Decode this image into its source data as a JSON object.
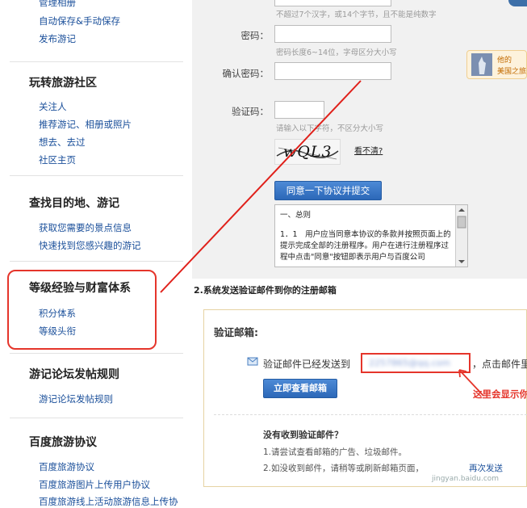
{
  "sidebar": {
    "top_links": [
      "管理相册",
      "自动保存&手动保存",
      "发布游记"
    ],
    "sections": [
      {
        "title": "玩转旅游社区",
        "links": [
          "关注人",
          "推荐游记、相册或照片",
          "想去、去过",
          "社区主页"
        ]
      },
      {
        "title": "查找目的地、游记",
        "links": [
          "获取您需要的景点信息",
          "快速找到您感兴趣的游记"
        ]
      },
      {
        "title": "等级经验与财富体系",
        "links": [
          "积分体系",
          "等级头衔"
        ]
      },
      {
        "title": "游记论坛发帖规则",
        "links": [
          "游记论坛发帖规则"
        ]
      },
      {
        "title": "百度旅游协议",
        "links": [
          "百度旅游协议",
          "百度旅游图片上传用户协议",
          "百度旅游线上活动旅游信息上传协"
        ]
      }
    ]
  },
  "form": {
    "username_hint": "不超过7个汉字，或14个字节，且不能是纯数字",
    "password_label": "密码：",
    "password_hint": "密码长度6~14位，字母区分大小写",
    "confirm_label": "确认密码：",
    "captcha_label": "验证码：",
    "captcha_hint": "请输入以下字符，不区分大小写",
    "captcha_text": "wQL3",
    "cant_see": "看不清?",
    "submit_label": "同意一下协议并提交",
    "agreement_heading": "一、总则",
    "agreement_text": "1．1　用户应当同意本协议的条款并按照页面上的提示完成全部的注册程序。用户在进行注册程序过程中点击\"同意\"按钮即表示用户与百度公司"
  },
  "promo": {
    "text_line1": "他的",
    "text_line2": "美国之旅"
  },
  "step2": {
    "title": "2.系统发送验证邮件到你的注册邮箱"
  },
  "verify": {
    "title": "验证邮箱:",
    "sent_text": "验证邮件已经发送到",
    "email_blurred": "2257865@qq.com",
    "after_email": "，点击邮件里",
    "check_button": "立即查看邮箱",
    "annotation": "这里会显示你",
    "not_received_title": "没有收到验证邮件？",
    "tip1": "1.请尝试查看邮箱的广告、垃圾邮件。",
    "tip2_prefix": "2.如没收到邮件，请稍等或刷新邮箱页面，",
    "tip2_link": "再次发送",
    "watermark": "jingyan.baidu.com"
  }
}
